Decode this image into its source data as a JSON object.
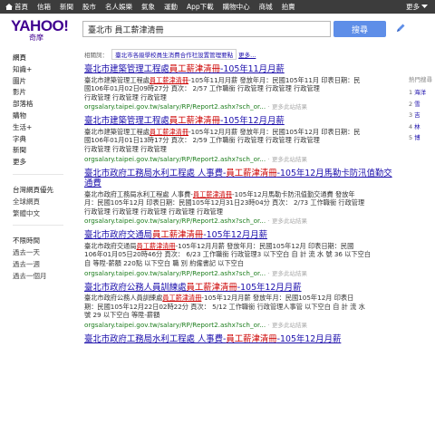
{
  "topnav": {
    "items": [
      "首頁",
      "信箱",
      "新聞",
      "股市",
      "名人娛樂",
      "氣象",
      "運動",
      "App下載",
      "購物中心",
      "商城",
      "拍賣"
    ],
    "more": "更多"
  },
  "logo": {
    "brand": "YAHOO!",
    "sub": "奇摩"
  },
  "search": {
    "value": "臺北市 員工薪津清冊",
    "button": "搜尋"
  },
  "sidebar": {
    "nav": [
      "網頁",
      "知識+",
      "圖片",
      "影片",
      "部落格",
      "購物",
      "生活+",
      "字典",
      "新聞",
      "更多"
    ],
    "region_head": "台灣網頁優先",
    "region_items": [
      "全球網頁",
      "繁體中文"
    ],
    "time_head": "不限時間",
    "time_items": [
      "過去一天",
      "過去一週",
      "過去一個月"
    ]
  },
  "related": {
    "label": "相關詞：",
    "link": "臺北市各級學校員生消費合作社設置管理要點",
    "more": "更多..."
  },
  "results": [
    {
      "title_pre": "臺北市建築管理工程處",
      "title_hl": "員工薪津清冊",
      "title_post": "-105年11月月薪",
      "snip1_pre": "臺北市建築管理工程處",
      "snip1_hl": "員工薪津清冊",
      "snip1_post": "-105年11月月薪 發放年月：民國105年11月 印表日期：民",
      "snip2": "國106年01月02日09時27分 頁次： 2/57 工作職銜 行政管理 行政管理 行政管理",
      "snip3": "行政管理 行政管理 行政管理",
      "url": "orgsalary.taipei.gov.tw/salary/RP/Report2.ashx?sch_or...",
      "more": "更多此站結果"
    },
    {
      "title_pre": "臺北市建築管理工程處",
      "title_hl": "員工薪津清冊",
      "title_post": "-105年12月月薪",
      "snip1_pre": "臺北市建築管理工程處",
      "snip1_hl": "員工薪津清冊",
      "snip1_post": "-105年12月月薪 發放年月：民國105年12月 印表日期：民",
      "snip2": "國106年01月01日13時17分 頁次： 2/59 工作職銜 行政管理 行政管理 行政管理",
      "snip3": "行政管理 行政管理 行政管理",
      "url": "orgsalary.taipei.gov.tw/salary/RP/Report2.ashx?sch_or...",
      "more": "更多此站結果"
    },
    {
      "title_pre": "臺北市政府工務局水利工程處 人事費-",
      "title_hl": "員工薪津清冊",
      "title_post": "-105年12月馬勒卡防汛值勤交通費",
      "snip1_pre": "臺北市政府工務局水利工程處 人事費-",
      "snip1_hl": "員工薪津清冊",
      "snip1_post": "-105年12月馬勒卡防汛值勤交通費 發放年",
      "snip2": "月：民國105年12月 印表日期：民國105年12月31日23時04分 頁次： 2/73 工作職銜 行政管理",
      "snip3": "行政管理 行政管理 行政管理 行政管理 行政管理",
      "url": "orgsalary.taipei.gov.tw/salary/RP/Report2.ashx?sch_or...",
      "more": "更多此站結果"
    },
    {
      "title_pre": "臺北市政府交通局",
      "title_hl": "員工薪津清冊",
      "title_post": "-105年12月月薪",
      "snip1_pre": "臺北市政府交通局",
      "snip1_hl": "員工薪津清冊",
      "snip1_post": "-105年12月月薪 發放年月：民國105年12月 印表日期：民國",
      "snip2": "106年01月05日20時46分 頁次： 6/23 工作職銜 行政管理3 以下空白 自 計 流 水 號 36 以下空白",
      "snip3": "自 等陞-薪額 220點 以下空白 職 別 約僱書記 以下空白",
      "url": "orgsalary.taipei.gov.tw/salary/RP/Report2.ashx?sch_or...",
      "more": "更多此站結果"
    },
    {
      "title_pre": "臺北市政府公務人員訓練處",
      "title_hl": "員工薪津清冊",
      "title_post": "-105年12月月薪",
      "snip1_pre": "臺北市政府公務人員訓練處",
      "snip1_hl": "員工薪津清冊",
      "snip1_post": "-105年12月月薪 發放年月：民國105年12月 印表日",
      "snip2": "期：民國105年12月22日02時22分 頁次： 5/12 工作職銜 行政管理人事管 以下空白 自 計 流 水",
      "snip3": "號 29 以下空白 等陞-薪額",
      "url": "orgsalary.taipei.gov.tw/salary/RP/Report2.ashx?sch_or...",
      "more": "更多此站結果"
    },
    {
      "title_pre": "臺北市政府工務局水利工程處 人事費-",
      "title_hl": "員工薪津清冊",
      "title_post": "-105年12月月薪",
      "snip1_pre": "",
      "snip1_hl": "",
      "snip1_post": "",
      "snip2": "",
      "snip3": "",
      "url": "",
      "more": ""
    }
  ],
  "right_panel": {
    "heading": "熱門搜尋",
    "items": [
      {
        "num": "1",
        "label": "海洋"
      },
      {
        "num": "2",
        "label": "雪"
      },
      {
        "num": "3",
        "label": "吉"
      },
      {
        "num": "4",
        "label": "林"
      },
      {
        "num": "5",
        "label": "博"
      }
    ]
  },
  "colors": {
    "link": "#1a0dab",
    "highlight": "#cc0000",
    "url": "#1e7e1e",
    "brand": "#400090",
    "button": "#5e8ee8",
    "topbar": "#3c3c3c"
  }
}
